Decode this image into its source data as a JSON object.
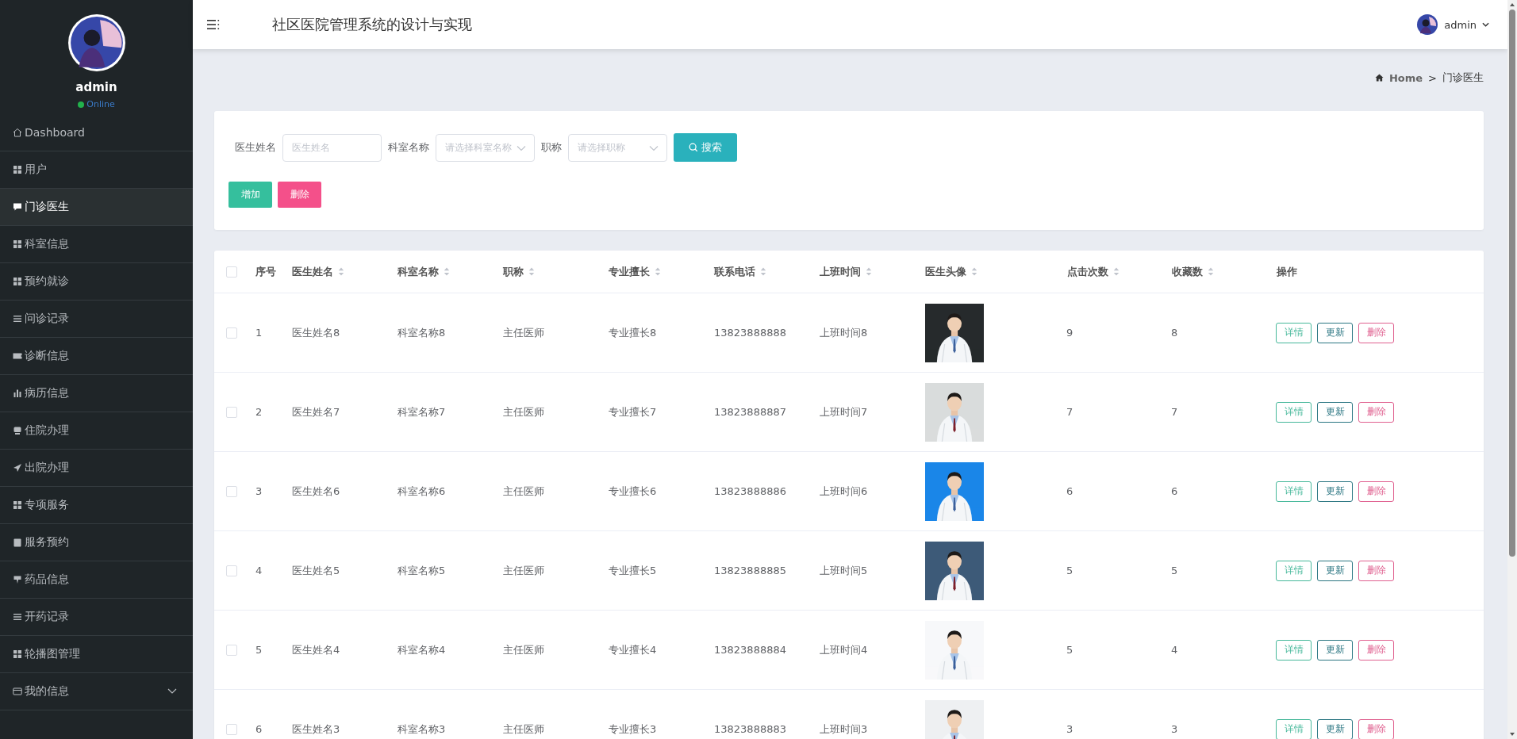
{
  "sidebar": {
    "user": {
      "name": "admin",
      "status": "Online"
    },
    "items": [
      {
        "label": "Dashboard",
        "selected": false
      },
      {
        "label": "用户",
        "selected": false
      },
      {
        "label": "门诊医生",
        "selected": true
      },
      {
        "label": "科室信息",
        "selected": false
      },
      {
        "label": "预约就诊",
        "selected": false
      },
      {
        "label": "问诊记录",
        "selected": false
      },
      {
        "label": "诊断信息",
        "selected": false
      },
      {
        "label": "病历信息",
        "selected": false
      },
      {
        "label": "住院办理",
        "selected": false
      },
      {
        "label": "出院办理",
        "selected": false
      },
      {
        "label": "专项服务",
        "selected": false
      },
      {
        "label": "服务预约",
        "selected": false
      },
      {
        "label": "药品信息",
        "selected": false
      },
      {
        "label": "开药记录",
        "selected": false
      },
      {
        "label": "轮播图管理",
        "selected": false
      },
      {
        "label": "我的信息",
        "selected": false,
        "expanded": false
      }
    ]
  },
  "header": {
    "title": "社区医院管理系统的设计与实现",
    "user": "admin"
  },
  "breadcrumb": [
    "Home",
    ">",
    "门诊医生"
  ],
  "search": {
    "fields": [
      {
        "label": "医生姓名",
        "placeholder": "医生姓名",
        "kind": "input"
      },
      {
        "label": "科室名称",
        "placeholder": "请选择科室名称",
        "kind": "select"
      },
      {
        "label": "职称",
        "placeholder": "请选择职称",
        "kind": "select"
      }
    ],
    "button": "搜索",
    "actions": [
      "增加",
      "删除"
    ]
  },
  "table": {
    "header_checked": false,
    "columns": [
      {
        "label": "序号",
        "sortable": false
      },
      {
        "label": "医生姓名",
        "sortable": true
      },
      {
        "label": "科室名称",
        "sortable": true
      },
      {
        "label": "职称",
        "sortable": true
      },
      {
        "label": "专业擅长",
        "sortable": true
      },
      {
        "label": "联系电话",
        "sortable": true
      },
      {
        "label": "上班时间",
        "sortable": true
      },
      {
        "label": "医生头像",
        "sortable": true
      },
      {
        "label": "点击次数",
        "sortable": true
      },
      {
        "label": "收藏数",
        "sortable": true
      },
      {
        "label": "操作",
        "sortable": false
      }
    ],
    "rows": [
      {
        "checked": false,
        "cells": [
          "1",
          "医生姓名8",
          "科室名称8",
          "主任医师",
          "专业擅长8",
          "13823888888",
          "上班时间8"
        ],
        "photo": {
          "kind": "picture"
        },
        "stats": [
          "9",
          "8"
        ],
        "buttons": [
          "详情",
          "更新",
          "删除"
        ]
      },
      {
        "checked": false,
        "cells": [
          "2",
          "医生姓名7",
          "科室名称7",
          "主任医师",
          "专业擅长7",
          "13823888887",
          "上班时间7"
        ],
        "photo": {
          "kind": "picture"
        },
        "stats": [
          "7",
          "7"
        ],
        "buttons": [
          "详情",
          "更新",
          "删除"
        ]
      },
      {
        "checked": false,
        "cells": [
          "3",
          "医生姓名6",
          "科室名称6",
          "主任医师",
          "专业擅长6",
          "13823888886",
          "上班时间6"
        ],
        "photo": {
          "kind": "picture"
        },
        "stats": [
          "6",
          "6"
        ],
        "buttons": [
          "详情",
          "更新",
          "删除"
        ]
      },
      {
        "checked": false,
        "cells": [
          "4",
          "医生姓名5",
          "科室名称5",
          "主任医师",
          "专业擅长5",
          "13823888885",
          "上班时间5"
        ],
        "photo": {
          "kind": "picture"
        },
        "stats": [
          "5",
          "5"
        ],
        "buttons": [
          "详情",
          "更新",
          "删除"
        ]
      },
      {
        "checked": false,
        "cells": [
          "5",
          "医生姓名4",
          "科室名称4",
          "主任医师",
          "专业擅长4",
          "13823888884",
          "上班时间4"
        ],
        "photo": {
          "kind": "picture"
        },
        "stats": [
          "5",
          "4"
        ],
        "buttons": [
          "详情",
          "更新",
          "删除"
        ]
      },
      {
        "checked": false,
        "cells": [
          "6",
          "医生姓名3",
          "科室名称3",
          "主任医师",
          "专业擅长3",
          "13823888883",
          "上班时间3"
        ],
        "photo": {
          "kind": "picture"
        },
        "stats": [
          "3",
          "3"
        ],
        "buttons": [
          "详情",
          "更新",
          "删除"
        ]
      }
    ]
  }
}
